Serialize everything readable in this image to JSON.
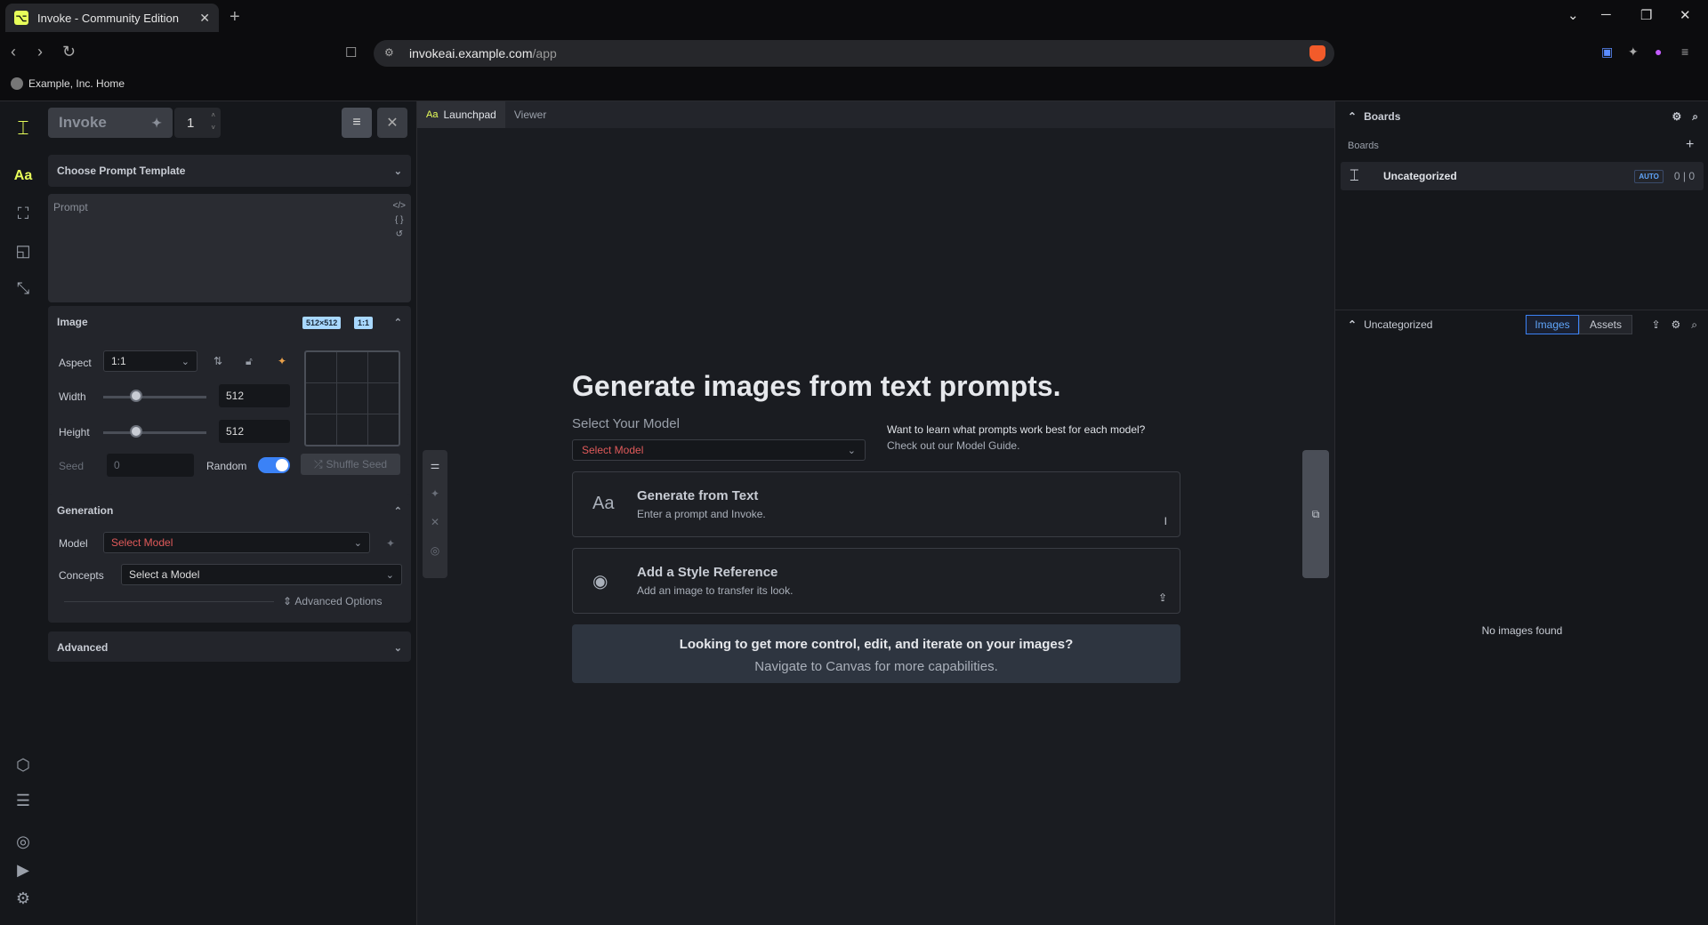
{
  "browser": {
    "tab_title": "Invoke - Community Edition",
    "url_host": "invokeai.example.com",
    "url_path": "/app",
    "bookmark": "Example, Inc. Home"
  },
  "left": {
    "invoke_label": "Invoke",
    "iterations": "1",
    "prompt_template": "Choose Prompt Template",
    "prompt_placeholder": "Prompt",
    "image": {
      "title": "Image",
      "size_badge": "512×512",
      "ratio_badge": "1:1",
      "aspect_label": "Aspect",
      "aspect_value": "1:1",
      "width_label": "Width",
      "width_value": "512",
      "height_label": "Height",
      "height_value": "512",
      "seed_label": "Seed",
      "seed_value": "0",
      "random_label": "Random",
      "shuffle_label": "Shuffle Seed"
    },
    "generation": {
      "title": "Generation",
      "model_label": "Model",
      "model_value": "Select Model",
      "concepts_label": "Concepts",
      "concepts_value": "Select a Model",
      "advanced_options": "Advanced Options"
    },
    "advanced_title": "Advanced"
  },
  "center": {
    "tabs": [
      "Launchpad",
      "Viewer"
    ],
    "tab_icon": "Aa",
    "hero": "Generate images from text prompts.",
    "select_model_label": "Select Your Model",
    "select_model_value": "Select Model",
    "guide_line1": "Want to learn what prompts work best for each model?",
    "guide_line2": "Check out our Model Guide.",
    "card1_title": "Generate from Text",
    "card1_sub": "Enter a prompt and Invoke.",
    "card1_icon": "Aa",
    "card2_title": "Add a Style Reference",
    "card2_sub": "Add an image to transfer its look.",
    "banner_line1": "Looking to get more control, edit, and iterate on your images?",
    "banner_line2": "Navigate to Canvas for more capabilities."
  },
  "right": {
    "boards_title": "Boards",
    "boards_sub": "Boards",
    "board_name": "Uncategorized",
    "auto_badge": "AUTO",
    "board_count": "0 | 0",
    "gallery_title": "Uncategorized",
    "images_tab": "Images",
    "assets_tab": "Assets",
    "empty": "No images found"
  },
  "colors": {
    "accent": "#e8ff5a",
    "link_blue": "#3b82f6",
    "error_red": "#e05a5a"
  }
}
